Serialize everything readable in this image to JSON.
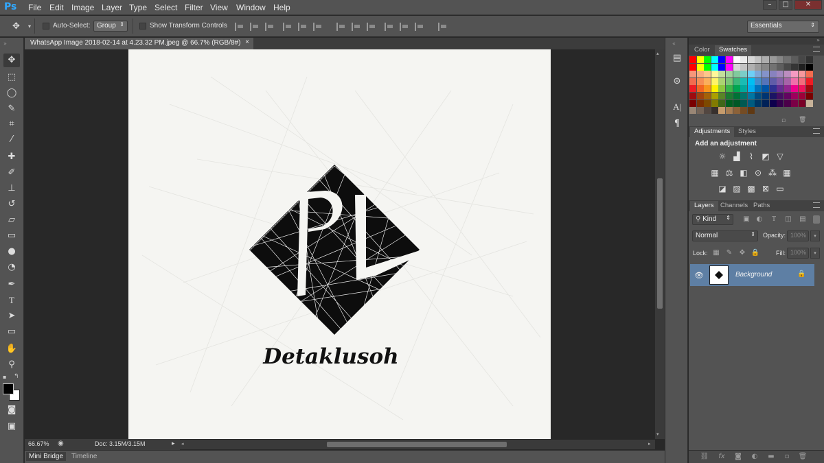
{
  "app": {
    "logo": "Ps"
  },
  "menu": [
    "File",
    "Edit",
    "Image",
    "Layer",
    "Type",
    "Select",
    "Filter",
    "View",
    "Window",
    "Help"
  ],
  "window_controls": [
    "–",
    "□",
    "✕"
  ],
  "options_bar": {
    "auto_select_label": "Auto-Select:",
    "auto_select_value": "Group",
    "transform_label": "Show Transform Controls",
    "workspace": "Essentials"
  },
  "document": {
    "tab_title": "WhatsApp Image 2018-02-14 at 4.23.32 PM.jpeg @ 66.7% (RGB/8#)",
    "close": "×",
    "zoom": "66.67%",
    "doc_size": "Doc: 3.15M/3.15M"
  },
  "artwork": {
    "letters": "PL",
    "brand": "Detaklusoh"
  },
  "bottom_tabs": [
    "Mini Bridge",
    "Timeline"
  ],
  "panels": {
    "color_tabs": [
      "Color",
      "Swatches"
    ],
    "adjustment_tabs": [
      "Adjustments",
      "Styles"
    ],
    "adjustments_heading": "Add an adjustment",
    "layers_tabs": [
      "Layers",
      "Channels",
      "Paths"
    ],
    "kind_label": "Kind",
    "blend_mode": "Normal",
    "opacity_label": "Opacity:",
    "opacity_value": "100%",
    "lock_label": "Lock:",
    "fill_label": "Fill:",
    "fill_value": "100%",
    "layer_name": "Background"
  },
  "swatch_colors": [
    [
      "#ff0000",
      "#ffff00",
      "#00ff00",
      "#00ffff",
      "#0000ff",
      "#ff00ff",
      "#ffffff",
      "#ebebeb",
      "#d6d6d6",
      "#c2c2c2",
      "#adadad",
      "#999999",
      "#858585",
      "#707070",
      "#5c5c5c",
      "#474747",
      "#333333"
    ],
    [
      "#ff0000",
      "#ffff00",
      "#00ff00",
      "#00ffff",
      "#0000ff",
      "#ff00ff",
      "#d9d9d9",
      "#c4c4c4",
      "#b0b0b0",
      "#9b9b9b",
      "#878787",
      "#727272",
      "#5e5e5e",
      "#494949",
      "#353535",
      "#202020",
      "#000000"
    ],
    [
      "#f7977a",
      "#f9ad81",
      "#fdc68a",
      "#fff79a",
      "#c4df9b",
      "#a2d39c",
      "#82ca9d",
      "#7bcdc8",
      "#6ecff6",
      "#7ea7d8",
      "#8493ca",
      "#8882be",
      "#a187be",
      "#bc8dbf",
      "#f49ac2",
      "#f6989d",
      "#f26c4f"
    ],
    [
      "#f26c4f",
      "#f68e55",
      "#fbaf5c",
      "#fff467",
      "#acd372",
      "#7cc576",
      "#3bb878",
      "#1abbb4",
      "#00bff3",
      "#438ccb",
      "#5574b9",
      "#605ca8",
      "#855fa8",
      "#a763a8",
      "#f06eaa",
      "#f26d7d",
      "#ed1c24"
    ],
    [
      "#ed1c24",
      "#f26522",
      "#f7941d",
      "#fff200",
      "#8dc73f",
      "#39b54a",
      "#00a651",
      "#00a99d",
      "#00aeef",
      "#0072bc",
      "#0054a6",
      "#2e3192",
      "#662d91",
      "#92278f",
      "#ec008c",
      "#ed145b",
      "#9e0b0f"
    ],
    [
      "#9e0b0f",
      "#a0410d",
      "#a36209",
      "#aba000",
      "#598527",
      "#1a7b30",
      "#007236",
      "#00746b",
      "#0076a3",
      "#004b80",
      "#003471",
      "#1b1464",
      "#440e62",
      "#630460",
      "#9e005d",
      "#9e0039",
      "#790000"
    ],
    [
      "#790000",
      "#7b2e00",
      "#7d4900",
      "#827b00",
      "#406618",
      "#005e20",
      "#005826",
      "#005952",
      "#005b7f",
      "#003663",
      "#002157",
      "#0d004c",
      "#32004b",
      "#4b0049",
      "#7b0046",
      "#7a0026",
      "#c7b299"
    ],
    [
      "#998675",
      "#736357",
      "#534741",
      "#37302d",
      "#c69c6d",
      "#a67c52",
      "#8c6239",
      "#754c24",
      "#603913"
    ]
  ],
  "layout_rows": 8
}
